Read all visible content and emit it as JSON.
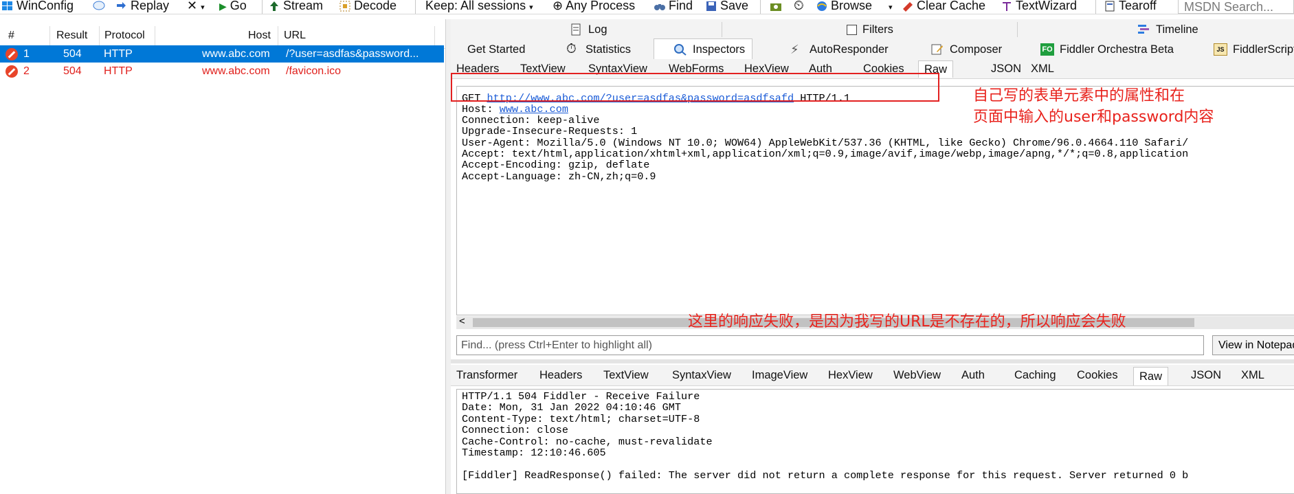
{
  "toolbar": {
    "winconfig": "WinConfig",
    "replay": "Replay",
    "remove": "✕",
    "go": "Go",
    "stream": "Stream",
    "decode": "Decode",
    "keep": "Keep: All sessions",
    "process": "Any Process",
    "find": "Find",
    "save": "Save",
    "browse": "Browse",
    "clear_cache": "Clear Cache",
    "textwizard": "TextWizard",
    "tearoff": "Tearoff",
    "search_placeholder": "MSDN Search..."
  },
  "sessions": {
    "columns": [
      "#",
      "Result",
      "Protocol",
      "Host",
      "URL"
    ],
    "rows": [
      {
        "num": "1",
        "result": "504",
        "protocol": "HTTP",
        "host": "www.abc.com",
        "url": "/?user=asdfas&password..."
      },
      {
        "num": "2",
        "result": "504",
        "protocol": "HTTP",
        "host": "www.abc.com",
        "url": "/favicon.ico"
      }
    ]
  },
  "top_tabs": {
    "log": "Log",
    "filters": "Filters",
    "timeline": "Timeline",
    "get_started": "Get Started",
    "statistics": "Statistics",
    "inspectors": "Inspectors",
    "autoresponder": "AutoResponder",
    "composer": "Composer",
    "orchestra": "Fiddler Orchestra Beta",
    "fiddlerscript": "FiddlerScript",
    "fo_badge": "FO",
    "js_badge": "JS"
  },
  "request_tabs": [
    "Headers",
    "TextView",
    "SyntaxView",
    "WebForms",
    "HexView",
    "Auth",
    "Cookies",
    "Raw",
    "JSON",
    "XML"
  ],
  "request": {
    "method": "GET",
    "url": "http://www.abc.com/?user=asdfas&password=asdfsafd",
    "version": "HTTP/1.1",
    "host_label": "Host:",
    "host_value": "www.abc.com",
    "lines": [
      "Connection: keep-alive",
      "Upgrade-Insecure-Requests: 1",
      "User-Agent: Mozilla/5.0 (Windows NT 10.0; WOW64) AppleWebKit/537.36 (KHTML, like Gecko) Chrome/96.0.4664.110 Safari/",
      "Accept: text/html,application/xhtml+xml,application/xml;q=0.9,image/avif,image/webp,image/apng,*/*;q=0.8,application",
      "Accept-Encoding: gzip, deflate",
      "Accept-Language: zh-CN,zh;q=0.9"
    ]
  },
  "annotations": {
    "line1": "自己写的表单元素中的属性和在",
    "line2": "页面中输入的user和password内容",
    "line3": "这里的响应失败，是因为我写的URL是不存在的，所以响应会失败",
    "color": "#e8221c"
  },
  "find": {
    "placeholder": "Find... (press Ctrl+Enter to highlight all)",
    "button": "View in Notepad"
  },
  "response_tabs": [
    "Transformer",
    "Headers",
    "TextView",
    "SyntaxView",
    "ImageView",
    "HexView",
    "WebView",
    "Auth",
    "Caching",
    "Cookies",
    "Raw",
    "JSON",
    "XML"
  ],
  "response": {
    "lines": [
      "HTTP/1.1 504 Fiddler - Receive Failure",
      "Date: Mon, 31 Jan 2022 04:10:46 GMT",
      "Content-Type: text/html; charset=UTF-8",
      "Connection: close",
      "Cache-Control: no-cache, must-revalidate",
      "Timestamp: 12:10:46.605",
      "",
      "[Fiddler] ReadResponse() failed: The server did not return a complete response for this request. Server returned 0 b"
    ]
  },
  "colors": {
    "selection": "#0078d7",
    "error_text": "#e0201c",
    "link": "#1a5ad6"
  }
}
